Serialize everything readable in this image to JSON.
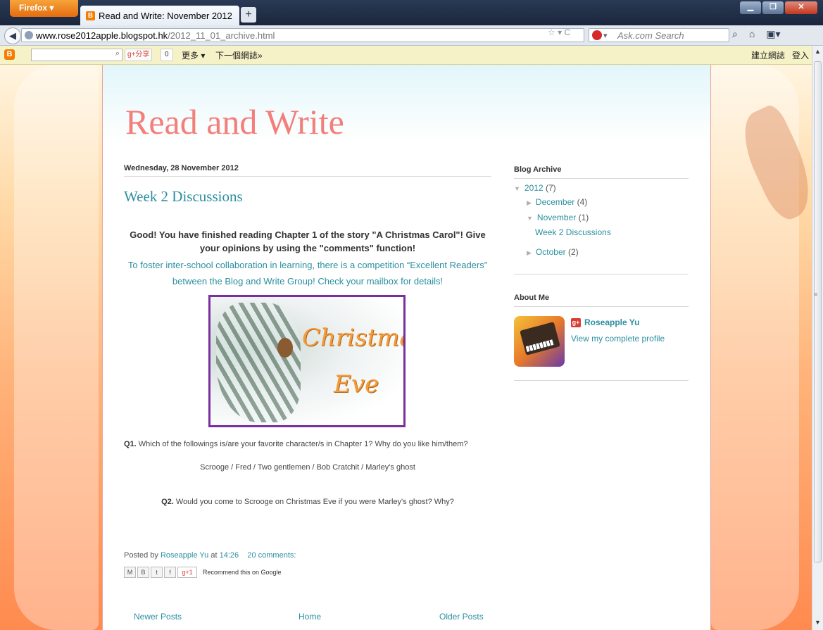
{
  "browser": {
    "firefox_label": "Firefox",
    "tab_title": "Read and Write: November 2012",
    "new_tab": "+",
    "url_host": "www.rose2012apple.blogspot.hk",
    "url_path": "/2012_11_01_archive.html",
    "search_placeholder": "Ask.com Search",
    "window_controls": [
      "▁",
      "❐",
      "✕"
    ]
  },
  "blogger_bar": {
    "share_label": "分享",
    "share_count": "0",
    "more_label": "更多 ▾",
    "next_blog_label": "下一個網誌»",
    "create_blog_label": "建立網誌",
    "login_label": "登入"
  },
  "blog": {
    "title": "Read and Write"
  },
  "post": {
    "date_header": "Wednesday, 28 November 2012",
    "title": "Week 2 Discussions",
    "lead": "Good! You have finished reading Chapter 1 of the story \"A Christmas Carol\"! Give your opinions by using the \"comments\" function!",
    "competition": "To foster inter-school collaboration in learning, there is a competition “Excellent Readers” between the Blog and Write Group! Check your mailbox for details!",
    "image_text_line1": "Christmas",
    "image_text_line2": "Eve",
    "q1_label": "Q1.",
    "q1_text": " Which of the followings is/are your favorite character/s in Chapter 1? Why do you like him/them?",
    "q1_choices": "Scrooge / Fred / Two gentlemen / Bob Cratchit / Marley's ghost",
    "q2_label": "Q2.",
    "q2_text": " Would you come to Scrooge on Christmas Eve if you were Marley's ghost? Why?",
    "posted_by_label": "Posted by ",
    "author": "Roseapple Yu",
    "at_label": " at ",
    "time": "14:26",
    "comments": "20 comments:",
    "share_buttons": [
      "M",
      "B",
      "t",
      "f",
      "g+1"
    ],
    "recommend_label": "Recommend this on Google"
  },
  "pager": {
    "newer": "Newer Posts",
    "home": "Home",
    "older": "Older Posts"
  },
  "sidebar": {
    "archive_header": "Blog Archive",
    "archive": {
      "year": "2012",
      "year_count": "(7)",
      "months": [
        {
          "name": "December",
          "count": "(4)",
          "expanded": false
        },
        {
          "name": "November",
          "count": "(1)",
          "expanded": true,
          "posts": [
            "Week 2 Discussions"
          ]
        },
        {
          "name": "October",
          "count": "(2)",
          "expanded": false
        }
      ]
    },
    "about_header": "About Me",
    "author_name": "Roseapple Yu",
    "view_profile": "View my complete profile"
  },
  "colors": {
    "title": "#f47e7a",
    "link": "#2b8fa0",
    "image_border": "#7a2fa0",
    "page_gradient_bottom": "#ff8a4f"
  },
  "icons": [
    "back-arrow-icon",
    "globe-icon",
    "star-icon",
    "reload-icon",
    "ask-icon",
    "search-icon",
    "home-icon",
    "bookmarks-icon",
    "blogger-logo-icon",
    "google-plus-icon"
  ]
}
